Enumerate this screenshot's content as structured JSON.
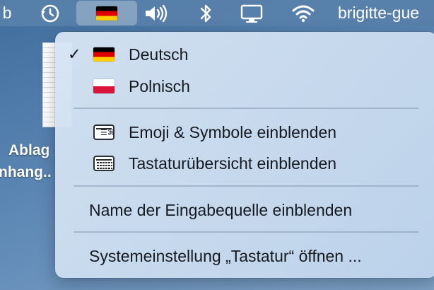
{
  "menubar": {
    "user_name": "brigitte-gue",
    "left_partial": "b",
    "icons": [
      "time-machine-icon",
      "input-source-flag-icon",
      "volume-icon",
      "bluetooth-icon",
      "display-icon",
      "wifi-icon"
    ]
  },
  "desktop": {
    "label_line1": "Ablag",
    "label_line2": "nhang.."
  },
  "input_menu": {
    "sources": [
      {
        "label": "Deutsch",
        "checked": true,
        "flag": "de"
      },
      {
        "label": "Polnisch",
        "checked": false,
        "flag": "pl"
      }
    ],
    "check_glyph": "✓",
    "emoji_label": "Emoji & Symbole einblenden",
    "keyboard_viewer_label": "Tastaturübersicht einblenden",
    "show_name_label": "Name der Eingabequelle einblenden",
    "settings_label": "Systemeinstellung „Tastatur“ öffnen ..."
  },
  "colors": {
    "menubar_bg": "#5880aa",
    "menu_bg": "#d0e0f0",
    "text": "#161a20"
  }
}
